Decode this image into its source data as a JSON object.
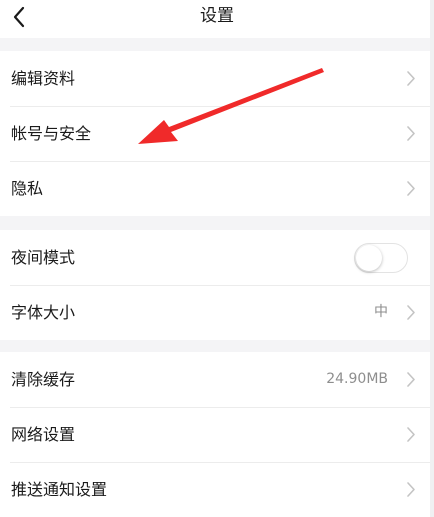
{
  "nav": {
    "title": "设置",
    "back_icon": "chevron-left-icon"
  },
  "groups": [
    {
      "items": [
        {
          "label": "编辑资料"
        },
        {
          "label": "帐号与安全"
        },
        {
          "label": "隐私"
        }
      ]
    },
    {
      "items": [
        {
          "label": "夜间模式",
          "control": "toggle",
          "on": false
        },
        {
          "label": "字体大小",
          "value": "中"
        }
      ]
    },
    {
      "items": [
        {
          "label": "清除缓存",
          "value": "24.90MB"
        },
        {
          "label": "网络设置"
        },
        {
          "label": "推送通知设置"
        }
      ]
    }
  ],
  "colors": {
    "background": "#f4f4f6",
    "surface": "#ffffff",
    "text": "#1a1a1a",
    "secondary_text": "#8e8e8e",
    "chevron": "#c4c4c4",
    "annotation_arrow": "#f02a2a"
  },
  "icons": {
    "row_arrow": "chevron-right-icon",
    "annotation": "red-arrow-icon"
  }
}
